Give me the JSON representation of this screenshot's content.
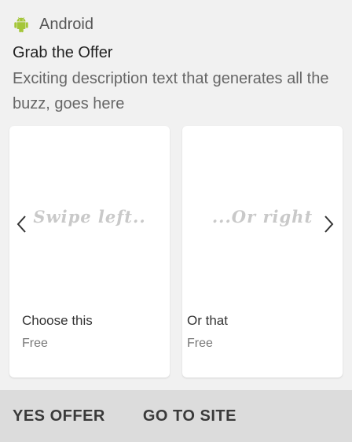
{
  "header": {
    "app_icon": "android-icon",
    "app_name": "Android",
    "accent_color": "#a4c639"
  },
  "notification": {
    "title": "Grab the Offer",
    "description": "Exciting description text that generates all the buzz, goes here"
  },
  "carousel": {
    "prev_icon": "chevron-left-icon",
    "next_icon": "chevron-right-icon",
    "cards": [
      {
        "image_text": "Swipe left..",
        "title": "Choose this",
        "subtitle": "Free"
      },
      {
        "image_text": "...Or right",
        "title": "Or that",
        "subtitle": "Free"
      }
    ]
  },
  "actions": {
    "primary_label": "YES OFFER",
    "secondary_label": "GO TO SITE"
  }
}
